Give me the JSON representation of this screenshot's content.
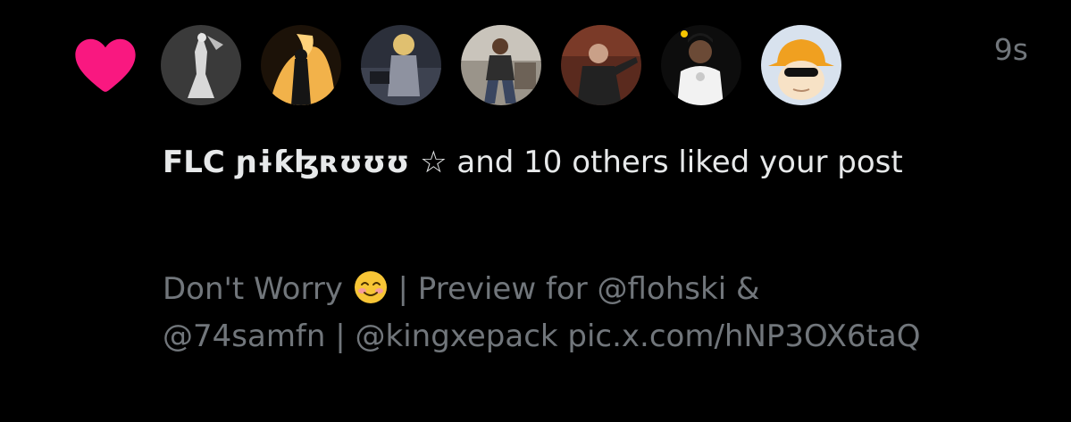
{
  "notification": {
    "type_icon": "heart-icon",
    "heart_color": "#f91880",
    "timestamp": "9s",
    "actor_name": "FLC ɲɨƙɮʀʊʊʊ ☆",
    "action_text": " and 10 others liked your post",
    "preview": {
      "text_before_emoji": "Don't Worry ",
      "emoji": "smiling-face-with-smiling-eyes-emoji",
      "text_after_emoji": " | Preview for @flohski & @74samfn | @kingxepack pic.x.com/hNP3OX6taQ"
    },
    "avatars": [
      {
        "name": "user-avatar-1"
      },
      {
        "name": "user-avatar-2"
      },
      {
        "name": "user-avatar-3"
      },
      {
        "name": "user-avatar-4"
      },
      {
        "name": "user-avatar-5"
      },
      {
        "name": "user-avatar-6"
      },
      {
        "name": "user-avatar-7"
      }
    ]
  },
  "colors": {
    "background": "#000000",
    "primary_text": "#e7e9ea",
    "secondary_text": "#71767b",
    "like_pink": "#f91880"
  }
}
